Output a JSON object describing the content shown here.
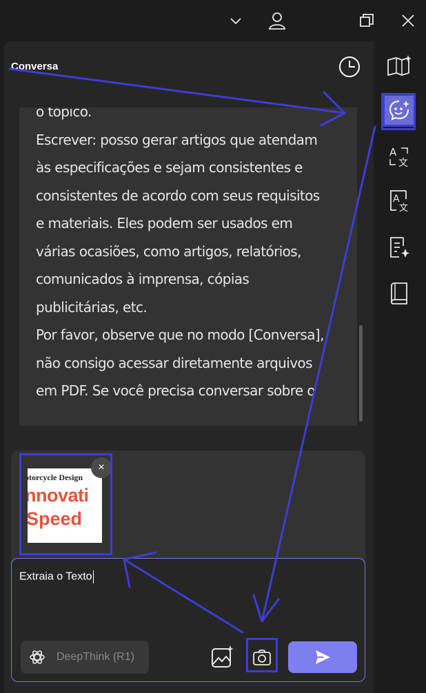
{
  "window": {
    "icons": [
      "chevron-down-icon",
      "user-icon",
      "restore-icon",
      "close-icon"
    ]
  },
  "panel": {
    "title": "Conversa",
    "history_icon": "clock-icon"
  },
  "sidebar": {
    "items": [
      {
        "name": "book-sparkle-icon",
        "active": false
      },
      {
        "name": "chat-ai-icon",
        "active": true
      },
      {
        "name": "translate-icon",
        "active": false
      },
      {
        "name": "translate-doc-icon",
        "active": false
      },
      {
        "name": "summary-icon",
        "active": false
      },
      {
        "name": "notebook-icon",
        "active": false
      }
    ]
  },
  "message": {
    "lines": [
      "o tópico.",
      "Escrever: posso gerar artigos que atendam",
      "às especificações e sejam consistentes e",
      "consistentes de acordo com seus requisitos",
      "e materiais. Eles podem ser usados em",
      "várias ocasiões, como artigos, relatórios,",
      "comunicados à imprensa, cópias",
      "publicitárias, etc.",
      "Por favor, observe que no modo [Conversa],",
      "não consigo acessar diretamente arquivos",
      "em PDF. Se você precisa conversar sobre o"
    ]
  },
  "attachment": {
    "line1": "otorcycle Design",
    "line2": "nnovati",
    "line3": "Speed",
    "close": "×"
  },
  "composer": {
    "text": "Extraia o Texto",
    "deepthink_label": "DeepThink (R1)",
    "accent": "#7e7ef0"
  },
  "annotation_color": "#3d3dd6"
}
